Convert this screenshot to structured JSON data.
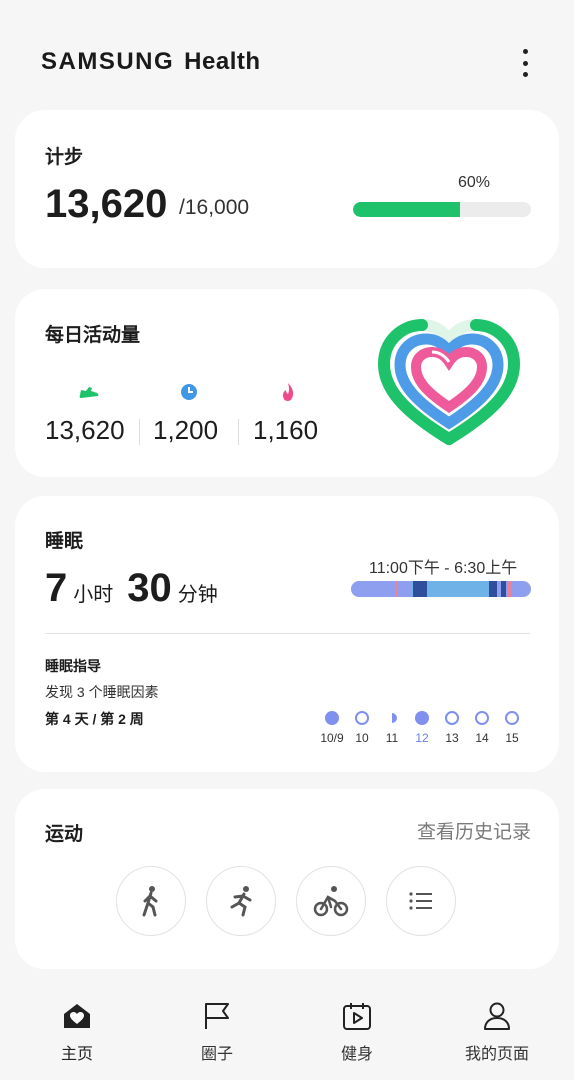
{
  "header": {
    "brand_part1": "SAMSUNG",
    "brand_part2": "Health"
  },
  "steps": {
    "title": "计步",
    "value": "13,620",
    "goal": "/16,000",
    "percent_label": "60%",
    "progress": 0.6,
    "color": "#1dc26b"
  },
  "activity": {
    "title": "每日活动量",
    "items": [
      {
        "icon": "shoe-icon",
        "value": "13,620",
        "color": "#1dc26b"
      },
      {
        "icon": "clock-icon",
        "value": "1,200",
        "color": "#3f97e6"
      },
      {
        "icon": "flame-icon",
        "value": "1,160",
        "color": "#ef4a8a"
      }
    ]
  },
  "sleep": {
    "title": "睡眠",
    "hours": "7",
    "hours_unit": "小时",
    "minutes": "30",
    "minutes_unit": "分钟",
    "range": "11:00下午 - 6:30上午",
    "coaching_title": "睡眠指导",
    "coaching_subtitle": "发现 3 个睡眠因素",
    "coaching_progress": "第 4 天 / 第 2 周",
    "days": [
      {
        "label": "10/9",
        "state": "full"
      },
      {
        "label": "10",
        "state": "empty"
      },
      {
        "label": "11",
        "state": "half"
      },
      {
        "label": "12",
        "state": "full",
        "active": true
      },
      {
        "label": "13",
        "state": "empty"
      },
      {
        "label": "14",
        "state": "empty"
      },
      {
        "label": "15",
        "state": "empty"
      }
    ]
  },
  "exercise": {
    "title": "运动",
    "history_link": "查看历史记录",
    "buttons": [
      "walk-icon",
      "run-icon",
      "cycle-icon",
      "list-icon"
    ]
  },
  "nav": {
    "items": [
      {
        "label": "主页",
        "icon": "home-heart-icon",
        "active": true
      },
      {
        "label": "圈子",
        "icon": "flag-icon"
      },
      {
        "label": "健身",
        "icon": "calendar-play-icon"
      },
      {
        "label": "我的页面",
        "icon": "person-icon"
      }
    ]
  }
}
